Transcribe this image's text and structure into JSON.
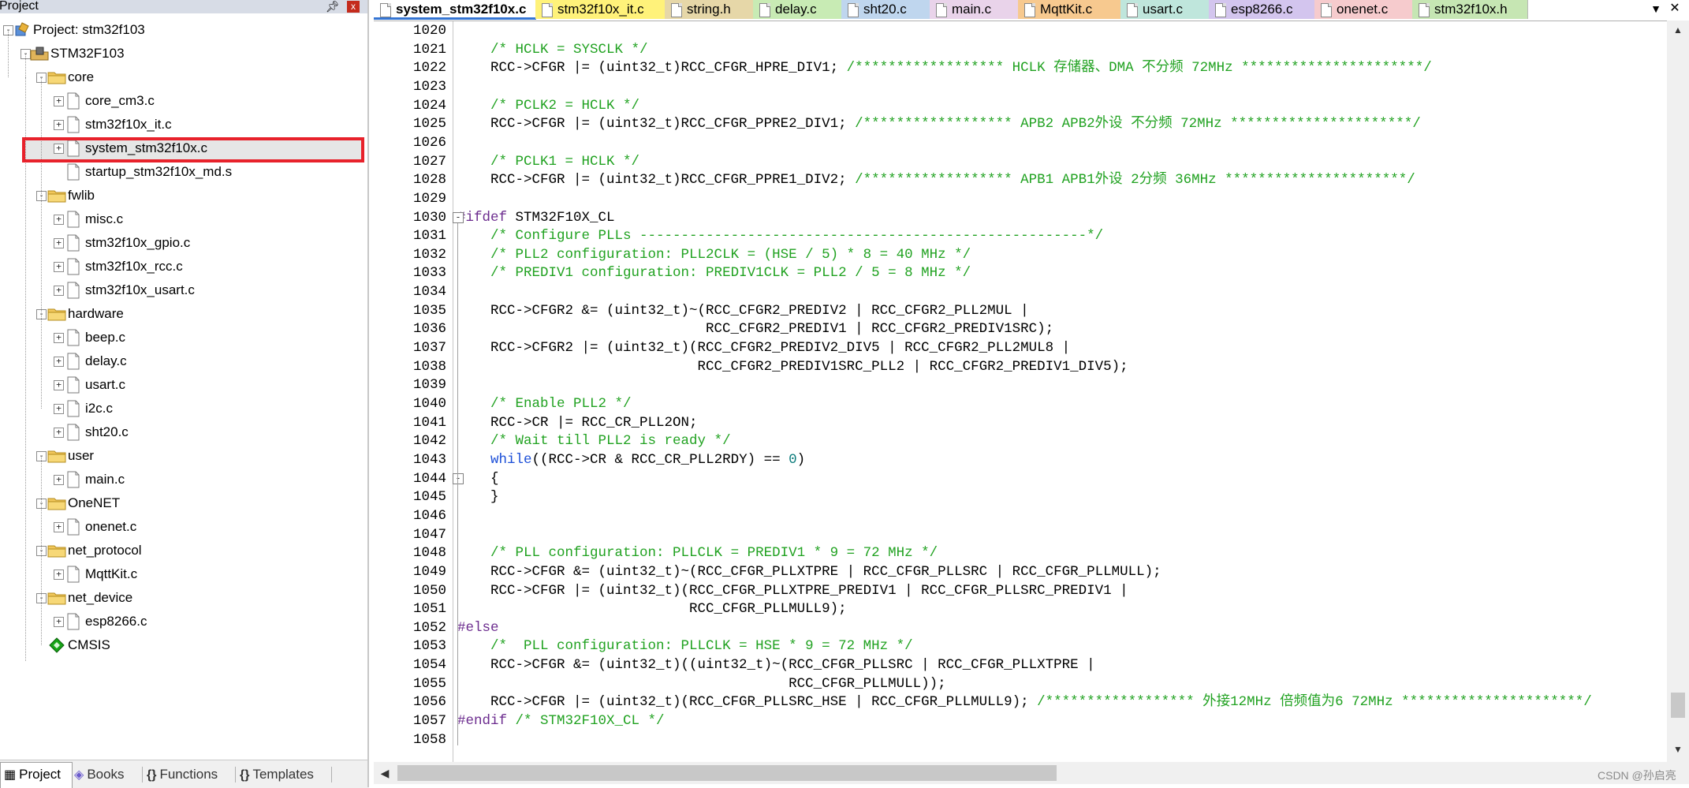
{
  "project_pane": {
    "title": "Project",
    "pin_icon": "pin-icon",
    "close_label": "x",
    "tree": [
      {
        "id": "root",
        "label": "Project: stm32f103",
        "expander": "-",
        "icon": "project-icon"
      },
      {
        "id": "target",
        "label": "STM32F103",
        "expander": "-",
        "icon": "target-icon"
      },
      {
        "id": "g-core",
        "label": "core",
        "expander": "-",
        "icon": "folder-icon"
      },
      {
        "id": "f-core_cm3",
        "label": "core_cm3.c",
        "expander": "+",
        "icon": "file-icon"
      },
      {
        "id": "f-stm32f10x_it",
        "label": "stm32f10x_it.c",
        "expander": "+",
        "icon": "file-icon"
      },
      {
        "id": "f-system",
        "label": "system_stm32f10x.c",
        "expander": "+",
        "icon": "file-icon"
      },
      {
        "id": "f-startup",
        "label": "startup_stm32f10x_md.s",
        "expander": "",
        "icon": "file-icon"
      },
      {
        "id": "g-fwlib",
        "label": "fwlib",
        "expander": "-",
        "icon": "folder-icon"
      },
      {
        "id": "f-misc",
        "label": "misc.c",
        "expander": "+",
        "icon": "file-icon"
      },
      {
        "id": "f-gpio",
        "label": "stm32f10x_gpio.c",
        "expander": "+",
        "icon": "file-icon"
      },
      {
        "id": "f-rcc",
        "label": "stm32f10x_rcc.c",
        "expander": "+",
        "icon": "file-icon"
      },
      {
        "id": "f-usart_lib",
        "label": "stm32f10x_usart.c",
        "expander": "+",
        "icon": "file-icon"
      },
      {
        "id": "g-hardware",
        "label": "hardware",
        "expander": "-",
        "icon": "folder-icon"
      },
      {
        "id": "f-beep",
        "label": "beep.c",
        "expander": "+",
        "icon": "file-icon"
      },
      {
        "id": "f-delay",
        "label": "delay.c",
        "expander": "+",
        "icon": "file-icon"
      },
      {
        "id": "f-usart",
        "label": "usart.c",
        "expander": "+",
        "icon": "file-icon"
      },
      {
        "id": "f-i2c",
        "label": "i2c.c",
        "expander": "+",
        "icon": "file-icon"
      },
      {
        "id": "f-sht20",
        "label": "sht20.c",
        "expander": "+",
        "icon": "file-icon"
      },
      {
        "id": "g-user",
        "label": "user",
        "expander": "-",
        "icon": "folder-icon"
      },
      {
        "id": "f-main",
        "label": "main.c",
        "expander": "+",
        "icon": "file-icon"
      },
      {
        "id": "g-onenet",
        "label": "OneNET",
        "expander": "-",
        "icon": "folder-icon"
      },
      {
        "id": "f-onenet",
        "label": "onenet.c",
        "expander": "+",
        "icon": "file-icon"
      },
      {
        "id": "g-net_protocol",
        "label": "net_protocol",
        "expander": "-",
        "icon": "folder-icon"
      },
      {
        "id": "f-mqttkit",
        "label": "MqttKit.c",
        "expander": "+",
        "icon": "file-icon"
      },
      {
        "id": "g-net_device",
        "label": "net_device",
        "expander": "-",
        "icon": "folder-icon"
      },
      {
        "id": "f-esp8266",
        "label": "esp8266.c",
        "expander": "+",
        "icon": "file-icon"
      },
      {
        "id": "cmsis",
        "label": "CMSIS",
        "expander": "",
        "icon": "cmsis-diamond-icon"
      }
    ],
    "bottom_tabs": [
      {
        "label": "Project",
        "icon": "project-tab-icon",
        "active": true
      },
      {
        "label": "Books",
        "icon": "books-icon",
        "active": false
      },
      {
        "label": "Functions",
        "icon": "functions-icon",
        "active": false
      },
      {
        "label": "Templates",
        "icon": "templates-icon",
        "active": false
      }
    ]
  },
  "editor_tabs": [
    {
      "label": "system_stm32f10x.c",
      "color": "#ffffff",
      "active": true
    },
    {
      "label": "stm32f10x_it.c",
      "color": "#fff27a",
      "active": false
    },
    {
      "label": "string.h",
      "color": "#e6d7a8",
      "active": false
    },
    {
      "label": "delay.c",
      "color": "#c8ebb4",
      "active": false
    },
    {
      "label": "sht20.c",
      "color": "#bfd6ee",
      "active": false
    },
    {
      "label": "main.c",
      "color": "#e9d3ea",
      "active": false
    },
    {
      "label": "MqttKit.c",
      "color": "#f7c98f",
      "active": false
    },
    {
      "label": "usart.c",
      "color": "#bfe6dc",
      "active": false
    },
    {
      "label": "esp8266.c",
      "color": "#d3c5ee",
      "active": false
    },
    {
      "label": "onenet.c",
      "color": "#f6cbcd",
      "active": false
    },
    {
      "label": "stm32f10x.h",
      "color": "#c6e6b3",
      "active": false
    }
  ],
  "editor": {
    "first_line": 1020,
    "code_lines": [
      [],
      [
        [
          "    ",
          ""
        ],
        [
          "/* HCLK = SYSCLK */",
          "com"
        ]
      ],
      [
        [
          "    RCC->CFGR |= (uint32_t)RCC_CFGR_HPRE_DIV1; ",
          ""
        ],
        [
          "/****************** HCLK 存储器、DMA 不分频 72MHz **********************/",
          "com"
        ]
      ],
      [],
      [
        [
          "    ",
          ""
        ],
        [
          "/* PCLK2 = HCLK */",
          "com"
        ]
      ],
      [
        [
          "    RCC->CFGR |= (uint32_t)RCC_CFGR_PPRE2_DIV1; ",
          ""
        ],
        [
          "/****************** APB2 APB2外设 不分频 72MHz **********************/",
          "com"
        ]
      ],
      [],
      [
        [
          "    ",
          ""
        ],
        [
          "/* PCLK1 = HCLK */",
          "com"
        ]
      ],
      [
        [
          "    RCC->CFGR |= (uint32_t)RCC_CFGR_PPRE1_DIV2; ",
          ""
        ],
        [
          "/****************** APB1 APB1外设 2分频 36MHz **********************/",
          "com"
        ]
      ],
      [],
      [
        [
          "#ifdef",
          "pp"
        ],
        [
          " STM32F10X_CL",
          ""
        ]
      ],
      [
        [
          "    ",
          ""
        ],
        [
          "/* Configure PLLs ------------------------------------------------------*/",
          "com"
        ]
      ],
      [
        [
          "    ",
          ""
        ],
        [
          "/* PLL2 configuration: PLL2CLK = (HSE / 5) * 8 = 40 MHz */",
          "com"
        ]
      ],
      [
        [
          "    ",
          ""
        ],
        [
          "/* PREDIV1 configuration: PREDIV1CLK = PLL2 / 5 = 8 MHz */",
          "com"
        ]
      ],
      [],
      [
        [
          "    RCC->CFGR2 &= (uint32_t)~(RCC_CFGR2_PREDIV2 | RCC_CFGR2_PLL2MUL |",
          ""
        ]
      ],
      [
        [
          "                              RCC_CFGR2_PREDIV1 | RCC_CFGR2_PREDIV1SRC);",
          ""
        ]
      ],
      [
        [
          "    RCC->CFGR2 |= (uint32_t)(RCC_CFGR2_PREDIV2_DIV5 | RCC_CFGR2_PLL2MUL8 |",
          ""
        ]
      ],
      [
        [
          "                             RCC_CFGR2_PREDIV1SRC_PLL2 | RCC_CFGR2_PREDIV1_DIV5);",
          ""
        ]
      ],
      [],
      [
        [
          "    ",
          ""
        ],
        [
          "/* Enable PLL2 */",
          "com"
        ]
      ],
      [
        [
          "    RCC->CR |= RCC_CR_PLL2ON;",
          ""
        ]
      ],
      [
        [
          "    ",
          ""
        ],
        [
          "/* Wait till PLL2 is ready */",
          "com"
        ]
      ],
      [
        [
          "    ",
          ""
        ],
        [
          "while",
          "kw"
        ],
        [
          "((RCC->CR & RCC_CR_PLL2RDY) == ",
          ""
        ],
        [
          "0",
          "num"
        ],
        [
          ")",
          ""
        ]
      ],
      [
        [
          "    {",
          ""
        ]
      ],
      [
        [
          "    }",
          ""
        ]
      ],
      [],
      [],
      [
        [
          "    ",
          ""
        ],
        [
          "/* PLL configuration: PLLCLK = PREDIV1 * 9 = 72 MHz */",
          "com"
        ]
      ],
      [
        [
          "    RCC->CFGR &= (uint32_t)~(RCC_CFGR_PLLXTPRE | RCC_CFGR_PLLSRC | RCC_CFGR_PLLMULL);",
          ""
        ]
      ],
      [
        [
          "    RCC->CFGR |= (uint32_t)(RCC_CFGR_PLLXTPRE_PREDIV1 | RCC_CFGR_PLLSRC_PREDIV1 |",
          ""
        ]
      ],
      [
        [
          "                            RCC_CFGR_PLLMULL9);",
          ""
        ]
      ],
      [
        [
          "#else",
          "pp"
        ]
      ],
      [
        [
          "    ",
          ""
        ],
        [
          "/*  PLL configuration: PLLCLK = HSE * 9 = 72 MHz */",
          "com"
        ]
      ],
      [
        [
          "    RCC->CFGR &= (uint32_t)((uint32_t)~(RCC_CFGR_PLLSRC | RCC_CFGR_PLLXTPRE |",
          ""
        ]
      ],
      [
        [
          "                                        RCC_CFGR_PLLMULL));",
          ""
        ]
      ],
      [
        [
          "    RCC->CFGR |= (uint32_t)(RCC_CFGR_PLLSRC_HSE | RCC_CFGR_PLLMULL9); ",
          ""
        ],
        [
          "/****************** 外接12MHz 倍频值为6 72MHz **********************/",
          "com"
        ]
      ],
      [
        [
          "#endif",
          "pp"
        ],
        [
          " ",
          ""
        ],
        [
          "/* STM32F10X_CL */",
          "com"
        ]
      ],
      [
        [
          "",
          ""
        ]
      ]
    ]
  },
  "watermark": "CSDN @孙启亮",
  "colors": {
    "selection_box": "#e8222b",
    "comment": "#21a221",
    "keyword": "#1c4fd8",
    "preprocessor": "#6b2b8e",
    "number": "#0b7b7b"
  }
}
